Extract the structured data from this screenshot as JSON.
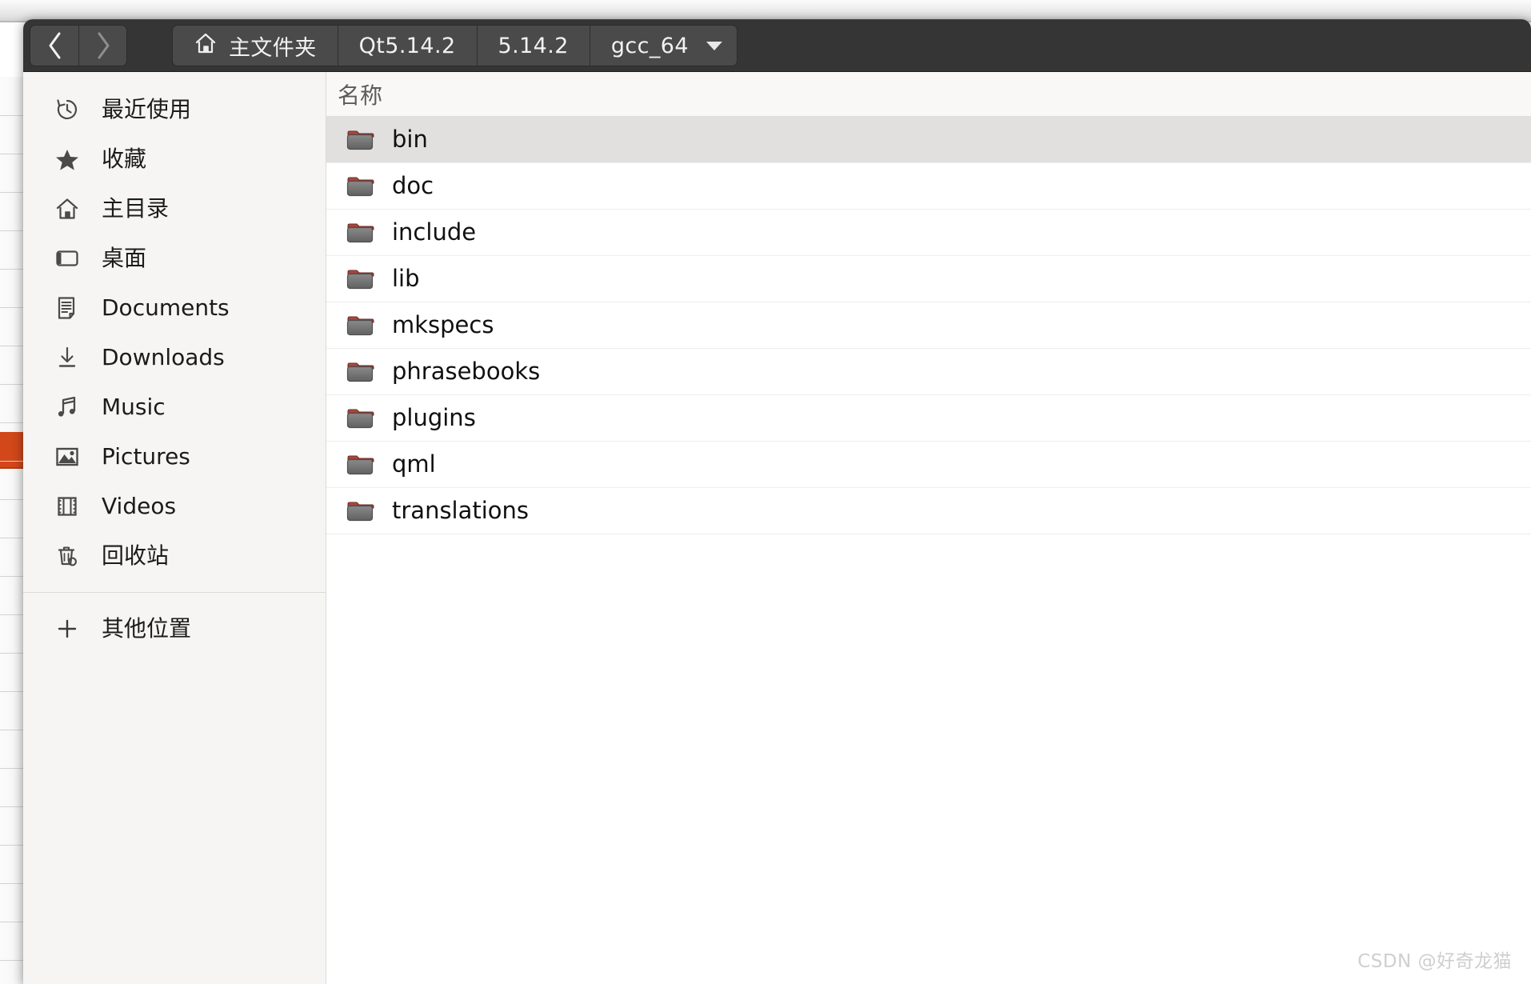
{
  "window": {
    "type": "gtk-file-chooser-dialog"
  },
  "headerbar": {
    "nav": {
      "back_label": "‹",
      "forward_label": "›",
      "back_name": "back-button",
      "forward_name": "forward-button"
    },
    "path_buttons": [
      {
        "label": "主文件夹",
        "icon": "home-icon",
        "has_icon": true,
        "has_caret": false
      },
      {
        "label": "Qt5.14.2",
        "icon": "",
        "has_icon": false,
        "has_caret": false
      },
      {
        "label": "5.14.2",
        "icon": "",
        "has_icon": false,
        "has_caret": false
      },
      {
        "label": "gcc_64",
        "icon": "chevron-down-icon",
        "has_icon": false,
        "has_caret": true
      }
    ]
  },
  "sidebar": {
    "items": [
      {
        "label": "最近使用",
        "icon": "recent-clock-icon"
      },
      {
        "label": "收藏",
        "icon": "star-icon"
      },
      {
        "label": "主目录",
        "icon": "home-icon"
      },
      {
        "label": "桌面",
        "icon": "desktop-icon"
      },
      {
        "label": "Documents",
        "icon": "document-icon"
      },
      {
        "label": "Downloads",
        "icon": "download-icon"
      },
      {
        "label": "Music",
        "icon": "music-note-icon"
      },
      {
        "label": "Pictures",
        "icon": "picture-icon"
      },
      {
        "label": "Videos",
        "icon": "video-film-icon"
      },
      {
        "label": "回收站",
        "icon": "trash-icon"
      }
    ],
    "other_locations": {
      "label": "其他位置",
      "icon": "plus-icon"
    }
  },
  "file_list": {
    "column_header": "名称",
    "rows": [
      {
        "name": "bin",
        "icon": "folder-icon",
        "selected": true
      },
      {
        "name": "doc",
        "icon": "folder-icon",
        "selected": false
      },
      {
        "name": "include",
        "icon": "folder-icon",
        "selected": false
      },
      {
        "name": "lib",
        "icon": "folder-icon",
        "selected": false
      },
      {
        "name": "mkspecs",
        "icon": "folder-icon",
        "selected": false
      },
      {
        "name": "phrasebooks",
        "icon": "folder-icon",
        "selected": false
      },
      {
        "name": "plugins",
        "icon": "folder-icon",
        "selected": false
      },
      {
        "name": "qml",
        "icon": "folder-icon",
        "selected": false
      },
      {
        "name": "translations",
        "icon": "folder-icon",
        "selected": false
      }
    ]
  },
  "watermark": {
    "text": "CSDN @好奇龙猫"
  },
  "colors": {
    "headerbar_bg": "#353535",
    "headerbar_button": "#4a4a4a",
    "sidebar_bg": "#f6f5f4",
    "selected_row": "#e2e0de",
    "backdrop_accent": "#d2481b",
    "folder_body": "#6e6e6e",
    "folder_tab": "#a03b34"
  }
}
